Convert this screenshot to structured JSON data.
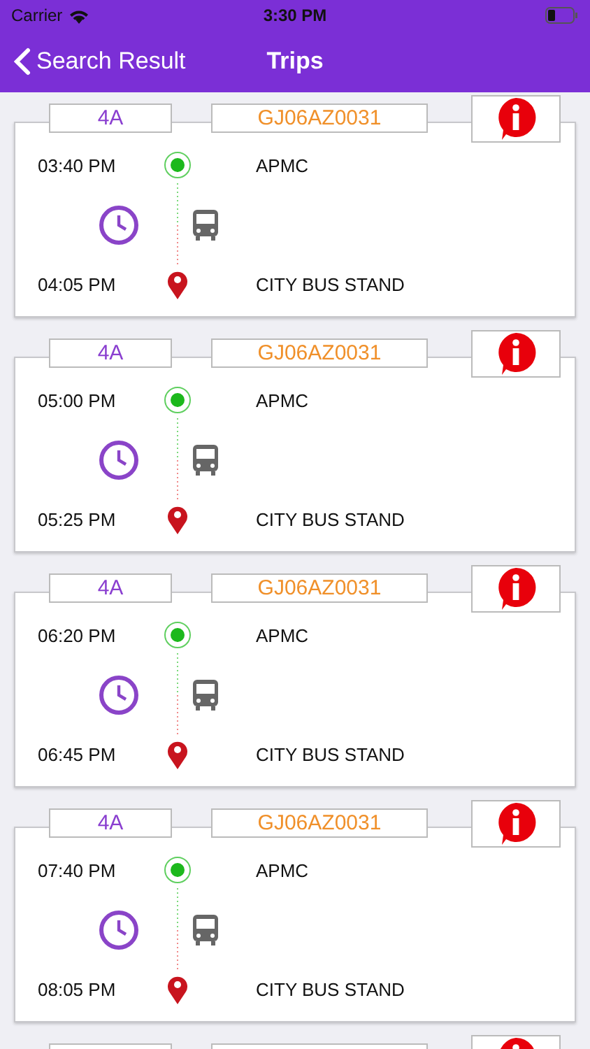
{
  "status_bar": {
    "carrier": "Carrier",
    "time": "3:30 PM"
  },
  "nav": {
    "back_label": "Search Result",
    "title": "Trips"
  },
  "trips": [
    {
      "route": "4A",
      "vehicle": "GJ06AZ0031",
      "departure_time": "03:40 PM",
      "origin": "APMC",
      "arrival_time": "04:05 PM",
      "destination": "CITY BUS STAND"
    },
    {
      "route": "4A",
      "vehicle": "GJ06AZ0031",
      "departure_time": "05:00 PM",
      "origin": "APMC",
      "arrival_time": "05:25 PM",
      "destination": "CITY BUS STAND"
    },
    {
      "route": "4A",
      "vehicle": "GJ06AZ0031",
      "departure_time": "06:20 PM",
      "origin": "APMC",
      "arrival_time": "06:45 PM",
      "destination": "CITY BUS STAND"
    },
    {
      "route": "4A",
      "vehicle": "GJ06AZ0031",
      "departure_time": "07:40 PM",
      "origin": "APMC",
      "arrival_time": "08:05 PM",
      "destination": "CITY BUS STAND"
    }
  ],
  "more_below": true
}
